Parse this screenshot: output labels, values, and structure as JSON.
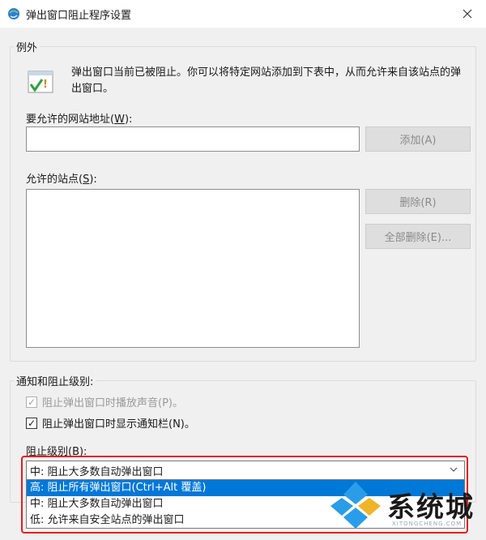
{
  "window": {
    "title": "弹出窗口阻止程序设置"
  },
  "exceptions": {
    "legend": "例外",
    "info_text": "弹出窗口当前已被阻止。你可以将特定网站添加到下表中，从而允许来自该站点的弹出窗口。",
    "address_label_pre": "要允许的网站地址(",
    "address_label_key": "W",
    "address_label_post": "):",
    "address_value": "",
    "add_button": "添加(A)",
    "allowed_label_pre": "允许的站点(",
    "allowed_label_key": "S",
    "allowed_label_post": "):",
    "allowed_sites": [],
    "remove_button": "删除(R)",
    "remove_all_button": "全部删除(E)..."
  },
  "notifications": {
    "legend": "通知和阻止级别:",
    "sound_checkbox": {
      "label": "阻止弹出窗口时播放声音(P)。",
      "checked": true,
      "disabled": true
    },
    "bar_checkbox": {
      "label": "阻止弹出窗口时显示通知栏(N)。",
      "checked": true,
      "disabled": false
    },
    "level_label": "阻止级别(B):",
    "level_selected": "中: 阻止大多数自动弹出窗口",
    "level_options": [
      "高: 阻止所有弹出窗口(Ctrl+Alt 覆盖)",
      "中: 阻止大多数自动弹出窗口",
      "低: 允许来自安全站点的弹出窗口"
    ],
    "highlighted_option_index": 0
  },
  "watermark": {
    "text": "系统城",
    "sub": "XITONGCHENG.COM"
  },
  "colors": {
    "highlight": "#0078d7",
    "annotation_frame": "#e02020",
    "disabled_button": "#dedede"
  }
}
